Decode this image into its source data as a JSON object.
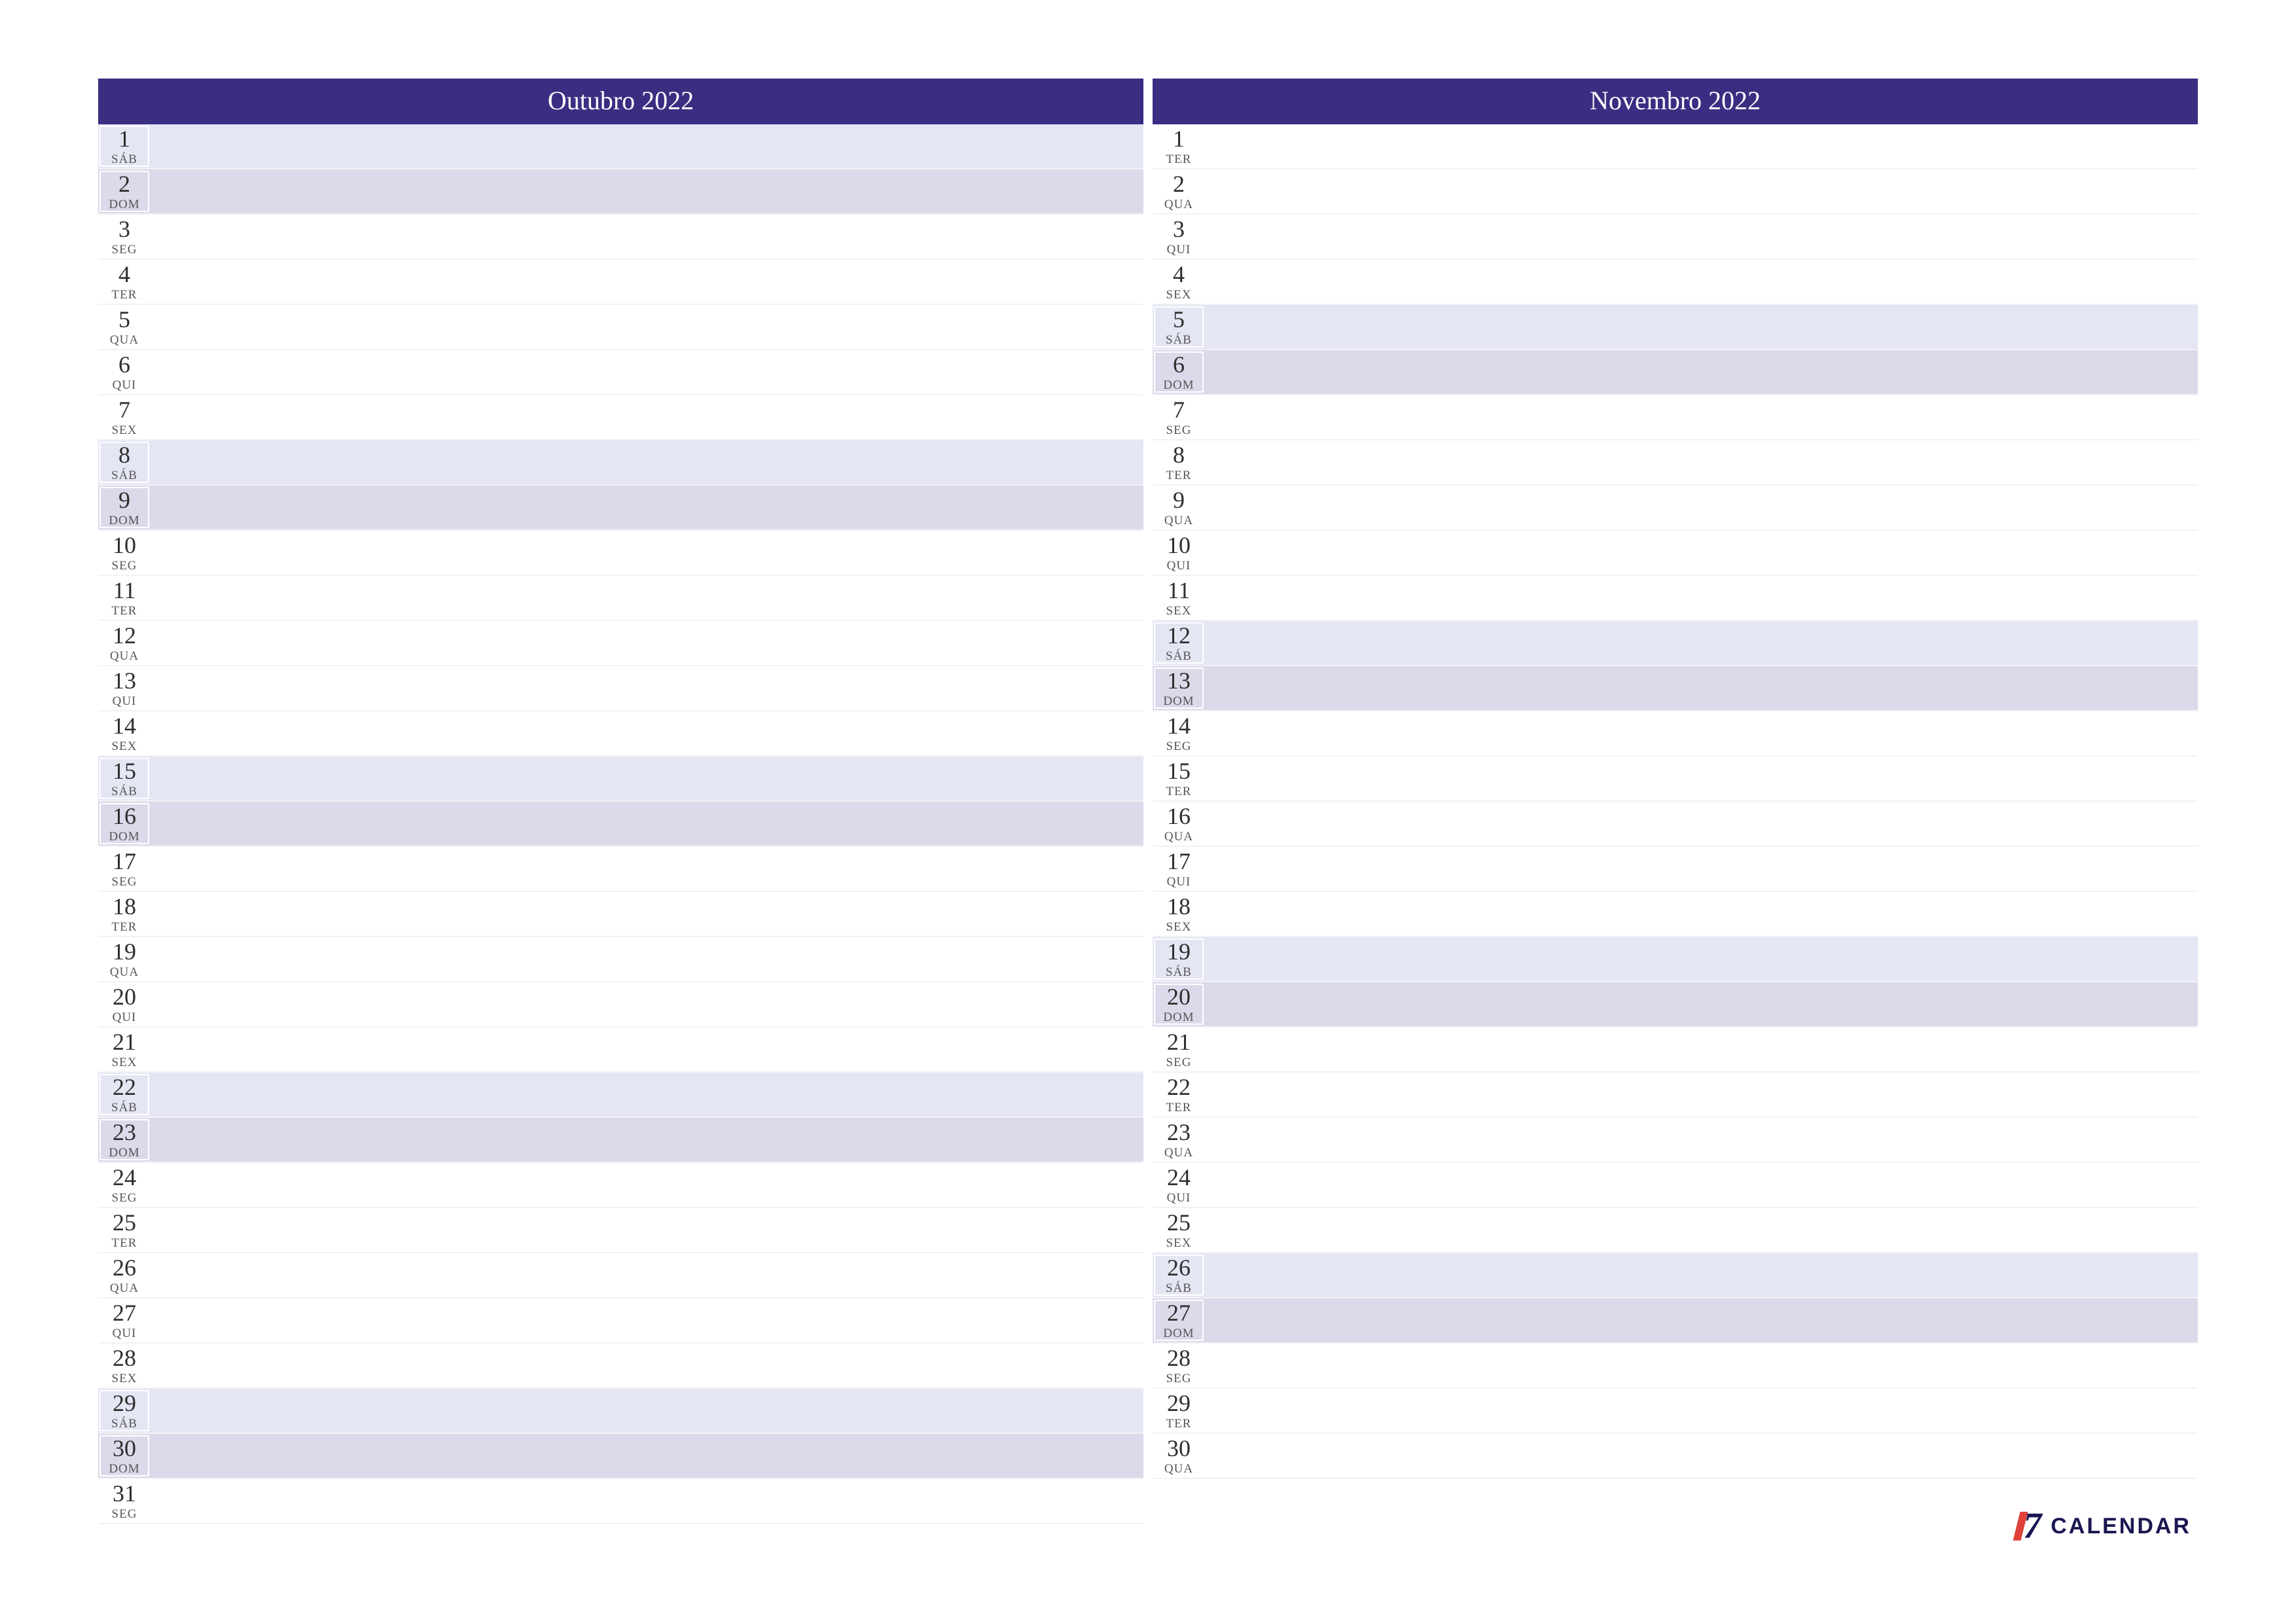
{
  "brand": {
    "mark": "7",
    "text": "CALENDAR"
  },
  "months": [
    {
      "title": "Outubro 2022",
      "days": [
        {
          "n": "1",
          "abbr": "SÁB",
          "cls": "sat"
        },
        {
          "n": "2",
          "abbr": "DOM",
          "cls": "sun"
        },
        {
          "n": "3",
          "abbr": "SEG",
          "cls": ""
        },
        {
          "n": "4",
          "abbr": "TER",
          "cls": ""
        },
        {
          "n": "5",
          "abbr": "QUA",
          "cls": ""
        },
        {
          "n": "6",
          "abbr": "QUI",
          "cls": ""
        },
        {
          "n": "7",
          "abbr": "SEX",
          "cls": ""
        },
        {
          "n": "8",
          "abbr": "SÁB",
          "cls": "sat"
        },
        {
          "n": "9",
          "abbr": "DOM",
          "cls": "sun"
        },
        {
          "n": "10",
          "abbr": "SEG",
          "cls": ""
        },
        {
          "n": "11",
          "abbr": "TER",
          "cls": ""
        },
        {
          "n": "12",
          "abbr": "QUA",
          "cls": ""
        },
        {
          "n": "13",
          "abbr": "QUI",
          "cls": ""
        },
        {
          "n": "14",
          "abbr": "SEX",
          "cls": ""
        },
        {
          "n": "15",
          "abbr": "SÁB",
          "cls": "sat"
        },
        {
          "n": "16",
          "abbr": "DOM",
          "cls": "sun"
        },
        {
          "n": "17",
          "abbr": "SEG",
          "cls": ""
        },
        {
          "n": "18",
          "abbr": "TER",
          "cls": ""
        },
        {
          "n": "19",
          "abbr": "QUA",
          "cls": ""
        },
        {
          "n": "20",
          "abbr": "QUI",
          "cls": ""
        },
        {
          "n": "21",
          "abbr": "SEX",
          "cls": ""
        },
        {
          "n": "22",
          "abbr": "SÁB",
          "cls": "sat"
        },
        {
          "n": "23",
          "abbr": "DOM",
          "cls": "sun"
        },
        {
          "n": "24",
          "abbr": "SEG",
          "cls": ""
        },
        {
          "n": "25",
          "abbr": "TER",
          "cls": ""
        },
        {
          "n": "26",
          "abbr": "QUA",
          "cls": ""
        },
        {
          "n": "27",
          "abbr": "QUI",
          "cls": ""
        },
        {
          "n": "28",
          "abbr": "SEX",
          "cls": ""
        },
        {
          "n": "29",
          "abbr": "SÁB",
          "cls": "sat"
        },
        {
          "n": "30",
          "abbr": "DOM",
          "cls": "sun"
        },
        {
          "n": "31",
          "abbr": "SEG",
          "cls": ""
        }
      ]
    },
    {
      "title": "Novembro 2022",
      "days": [
        {
          "n": "1",
          "abbr": "TER",
          "cls": ""
        },
        {
          "n": "2",
          "abbr": "QUA",
          "cls": ""
        },
        {
          "n": "3",
          "abbr": "QUI",
          "cls": ""
        },
        {
          "n": "4",
          "abbr": "SEX",
          "cls": ""
        },
        {
          "n": "5",
          "abbr": "SÁB",
          "cls": "sat"
        },
        {
          "n": "6",
          "abbr": "DOM",
          "cls": "sun"
        },
        {
          "n": "7",
          "abbr": "SEG",
          "cls": ""
        },
        {
          "n": "8",
          "abbr": "TER",
          "cls": ""
        },
        {
          "n": "9",
          "abbr": "QUA",
          "cls": ""
        },
        {
          "n": "10",
          "abbr": "QUI",
          "cls": ""
        },
        {
          "n": "11",
          "abbr": "SEX",
          "cls": ""
        },
        {
          "n": "12",
          "abbr": "SÁB",
          "cls": "sat"
        },
        {
          "n": "13",
          "abbr": "DOM",
          "cls": "sun"
        },
        {
          "n": "14",
          "abbr": "SEG",
          "cls": ""
        },
        {
          "n": "15",
          "abbr": "TER",
          "cls": ""
        },
        {
          "n": "16",
          "abbr": "QUA",
          "cls": ""
        },
        {
          "n": "17",
          "abbr": "QUI",
          "cls": ""
        },
        {
          "n": "18",
          "abbr": "SEX",
          "cls": ""
        },
        {
          "n": "19",
          "abbr": "SÁB",
          "cls": "sat"
        },
        {
          "n": "20",
          "abbr": "DOM",
          "cls": "sun"
        },
        {
          "n": "21",
          "abbr": "SEG",
          "cls": ""
        },
        {
          "n": "22",
          "abbr": "TER",
          "cls": ""
        },
        {
          "n": "23",
          "abbr": "QUA",
          "cls": ""
        },
        {
          "n": "24",
          "abbr": "QUI",
          "cls": ""
        },
        {
          "n": "25",
          "abbr": "SEX",
          "cls": ""
        },
        {
          "n": "26",
          "abbr": "SÁB",
          "cls": "sat"
        },
        {
          "n": "27",
          "abbr": "DOM",
          "cls": "sun"
        },
        {
          "n": "28",
          "abbr": "SEG",
          "cls": ""
        },
        {
          "n": "29",
          "abbr": "TER",
          "cls": ""
        },
        {
          "n": "30",
          "abbr": "QUA",
          "cls": ""
        }
      ]
    }
  ]
}
